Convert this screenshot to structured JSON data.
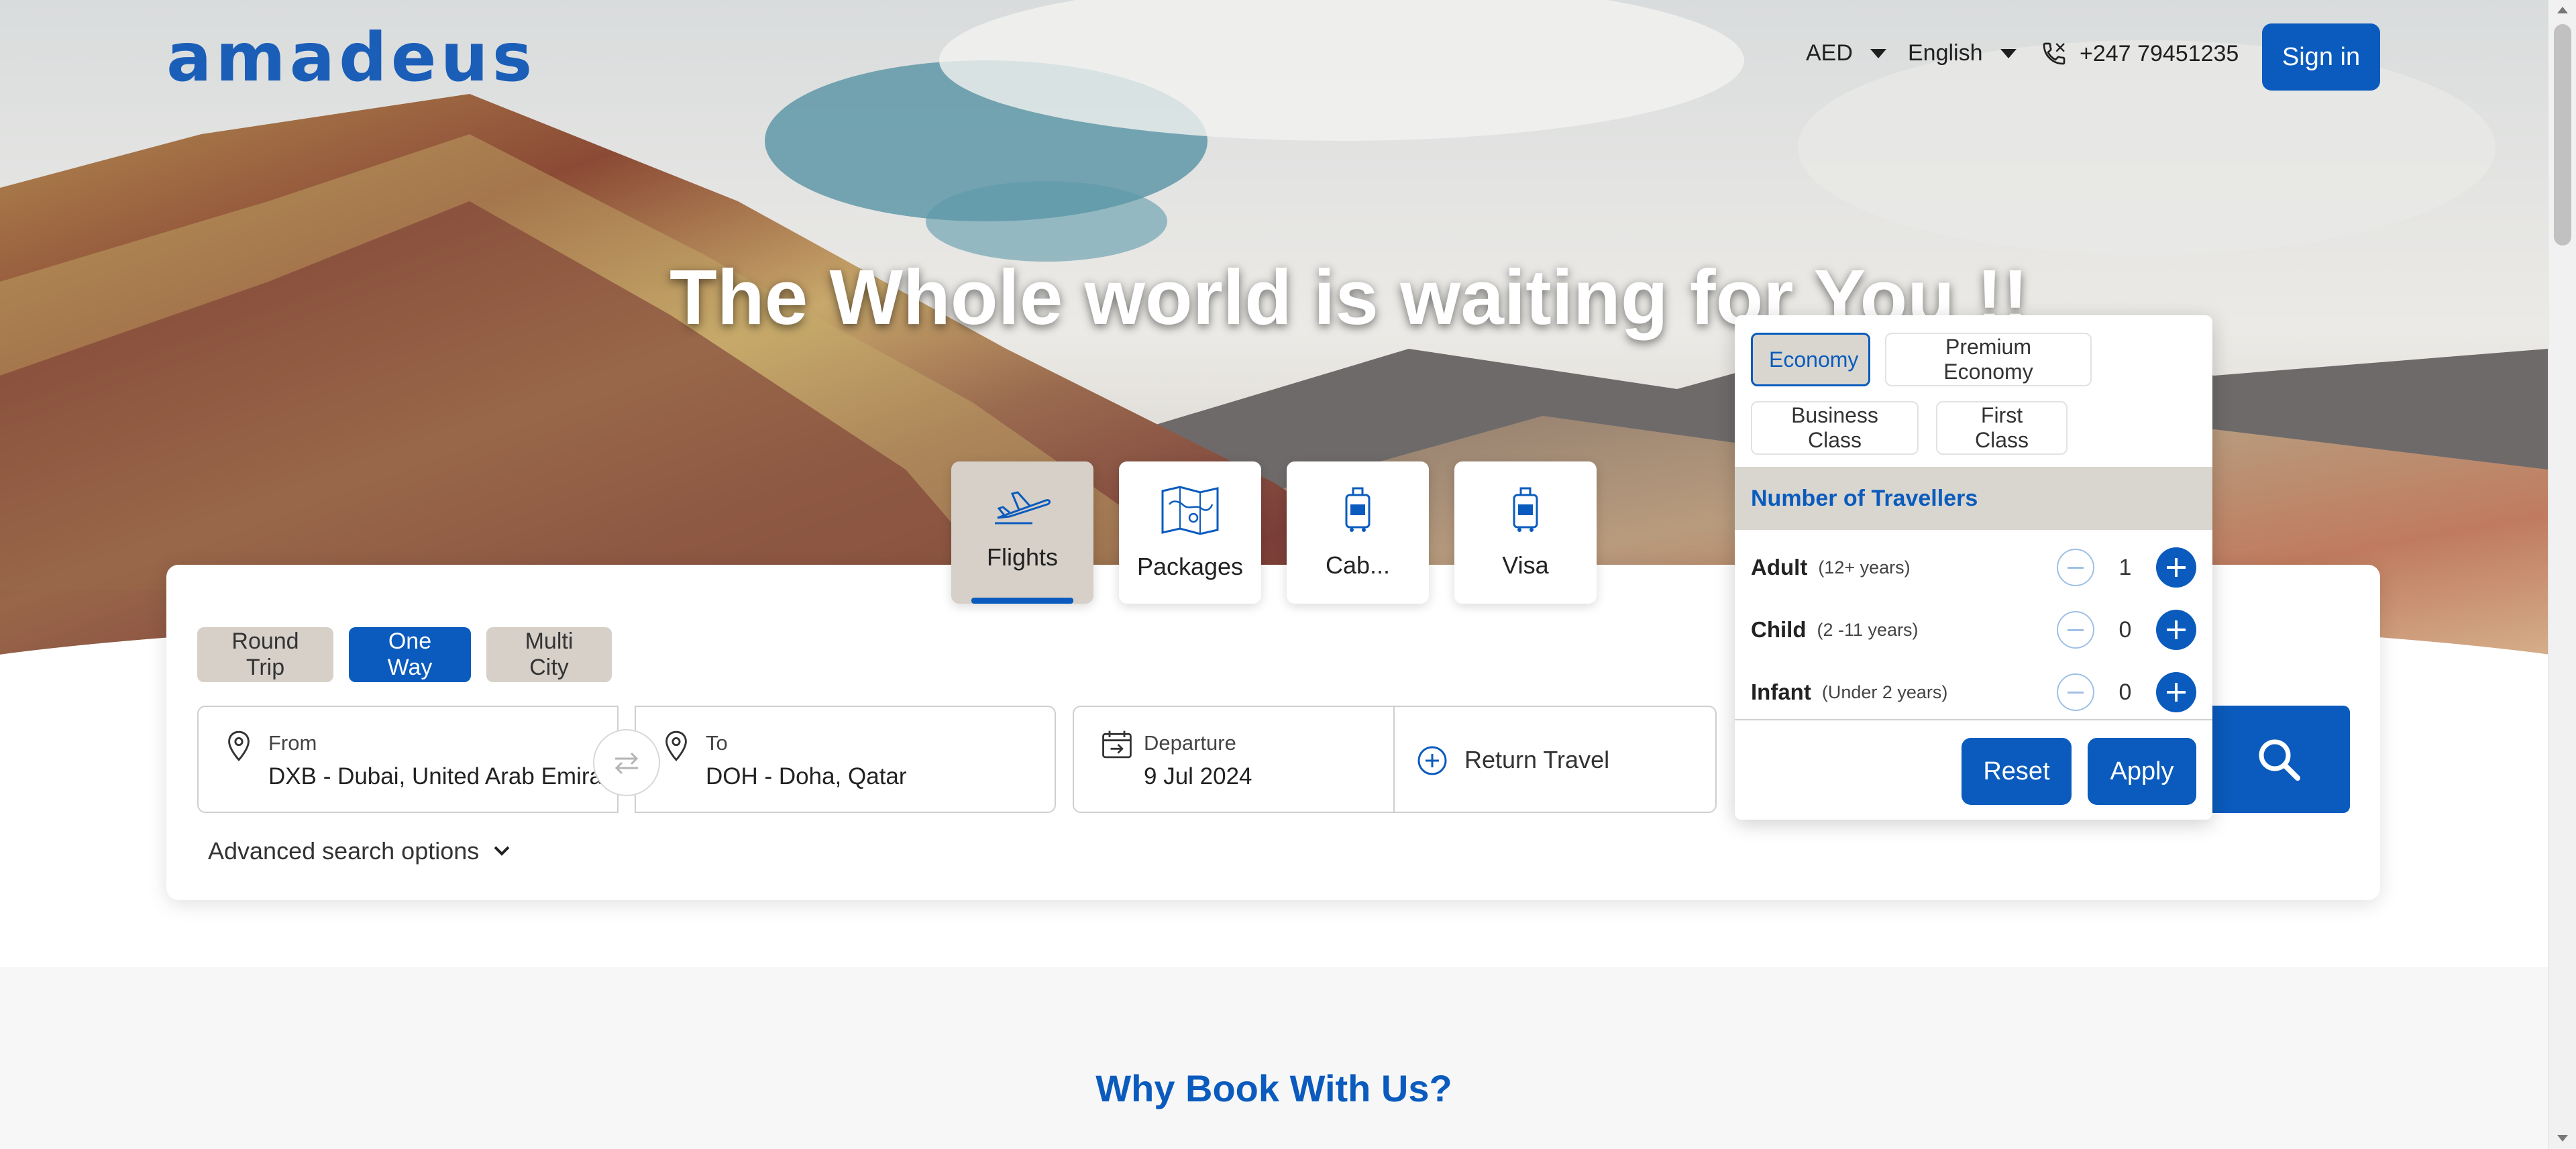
{
  "header": {
    "logo": "amadeus",
    "currency": "AED",
    "language": "English",
    "phone": "+247 79451235",
    "sign_in": "Sign in"
  },
  "hero": {
    "headline": "The Whole world is waiting for You !!"
  },
  "product_tabs": [
    {
      "label": "Flights",
      "icon": "plane-icon",
      "active": true
    },
    {
      "label": "Packages",
      "icon": "map-icon",
      "active": false
    },
    {
      "label": "Cab...",
      "icon": "luggage-icon",
      "active": false
    },
    {
      "label": "Visa",
      "icon": "luggage-icon",
      "active": false
    }
  ],
  "trip_types": [
    {
      "label": "Round Trip",
      "active": false
    },
    {
      "label": "One Way",
      "active": true
    },
    {
      "label": "Multi City",
      "active": false
    }
  ],
  "search": {
    "from_label": "From",
    "from_value": "DXB - Dubai, United Arab Emira...",
    "to_label": "To",
    "to_value": "DOH - Doha, Qatar",
    "departure_label": "Departure",
    "departure_value": "9 Jul 2024",
    "return_label": "Return Travel",
    "advanced": "Advanced search options"
  },
  "cabin_dropdown": {
    "classes": [
      {
        "label": "Economy",
        "selected": true
      },
      {
        "label": "Premium Economy",
        "selected": false
      },
      {
        "label": "Business Class",
        "selected": false
      },
      {
        "label": "First Class",
        "selected": false
      }
    ],
    "travellers_heading": "Number of Travellers",
    "travellers": [
      {
        "name": "Adult",
        "range": "(12+ years)",
        "count": "1"
      },
      {
        "name": "Child",
        "range": "(2 -11 years)",
        "count": "0"
      },
      {
        "name": "Infant",
        "range": "(Under 2 years)",
        "count": "0"
      }
    ],
    "reset": "Reset",
    "apply": "Apply"
  },
  "why": {
    "title": "Why Book With Us?"
  },
  "colors": {
    "brand_blue": "#0a5bbd",
    "tab_active_bg": "#d6d0c9"
  }
}
